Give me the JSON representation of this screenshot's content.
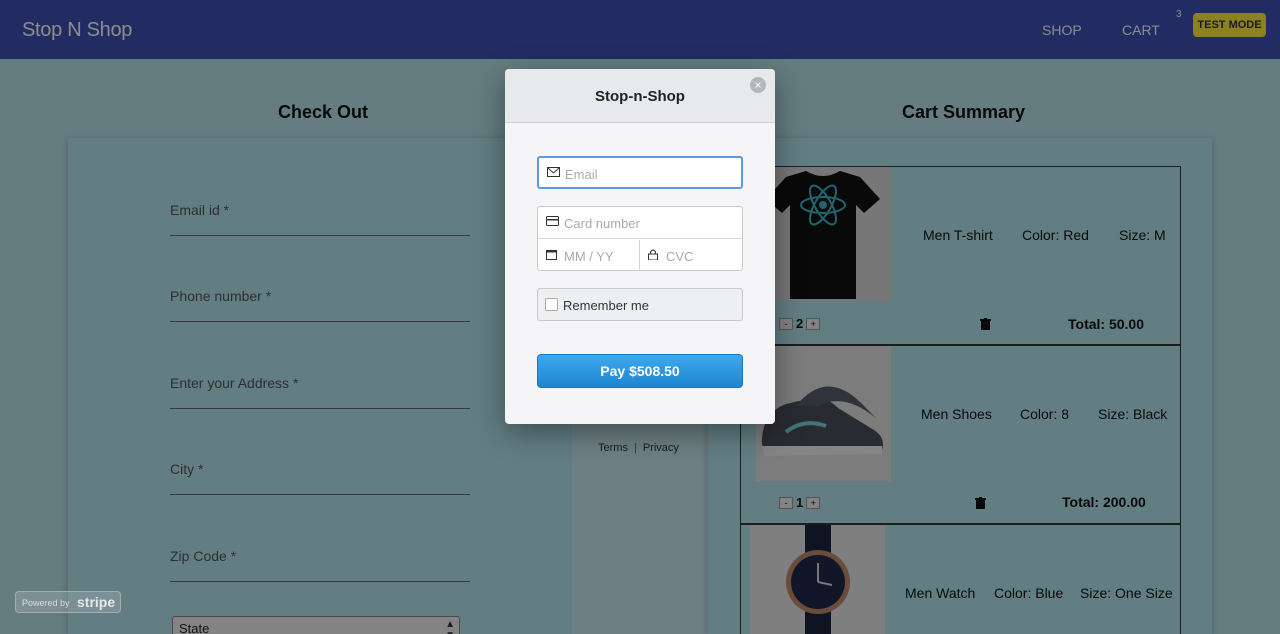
{
  "navbar": {
    "brand": "Stop N Shop",
    "shop_label": "SHOP",
    "cart_label": "CART",
    "cart_count": "3",
    "test_mode_label": "TEST MODE"
  },
  "checkout": {
    "title": "Check Out",
    "fields": [
      {
        "label": "Email id *"
      },
      {
        "label": "Phone number *"
      },
      {
        "label": "Enter your Address *"
      },
      {
        "label": "City *"
      },
      {
        "label": "Zip Code *"
      }
    ],
    "state_select": "State"
  },
  "cart": {
    "title": "Cart Summary",
    "items": [
      {
        "name": "Men T-shirt",
        "color": "Color: Red",
        "size": "Size: M",
        "qty": "2",
        "total": "Total: 50.00"
      },
      {
        "name": "Men Shoes",
        "color": "Color: 8",
        "size": "Size: Black",
        "qty": "1",
        "total": "Total: 200.00"
      },
      {
        "name": "Men Watch",
        "color": "Color: Blue",
        "size": "Size: One Size"
      }
    ]
  },
  "stripe_footer": {
    "terms": "Terms",
    "privacy": "Privacy"
  },
  "modal": {
    "title": "Stop-n-Shop",
    "email_placeholder": "Email",
    "card_placeholder": "Card number",
    "expiry_placeholder": "MM / YY",
    "cvc_placeholder": "CVC",
    "remember_label": "Remember me",
    "pay_label": "Pay $508.50"
  },
  "powered": {
    "by": "Powered by",
    "brand": "stripe"
  },
  "colors": {
    "navbar": "#3f51b5",
    "panel": "#b2e6ef",
    "pay_button": "#2594e0",
    "test_mode": "#ffeb3b"
  }
}
